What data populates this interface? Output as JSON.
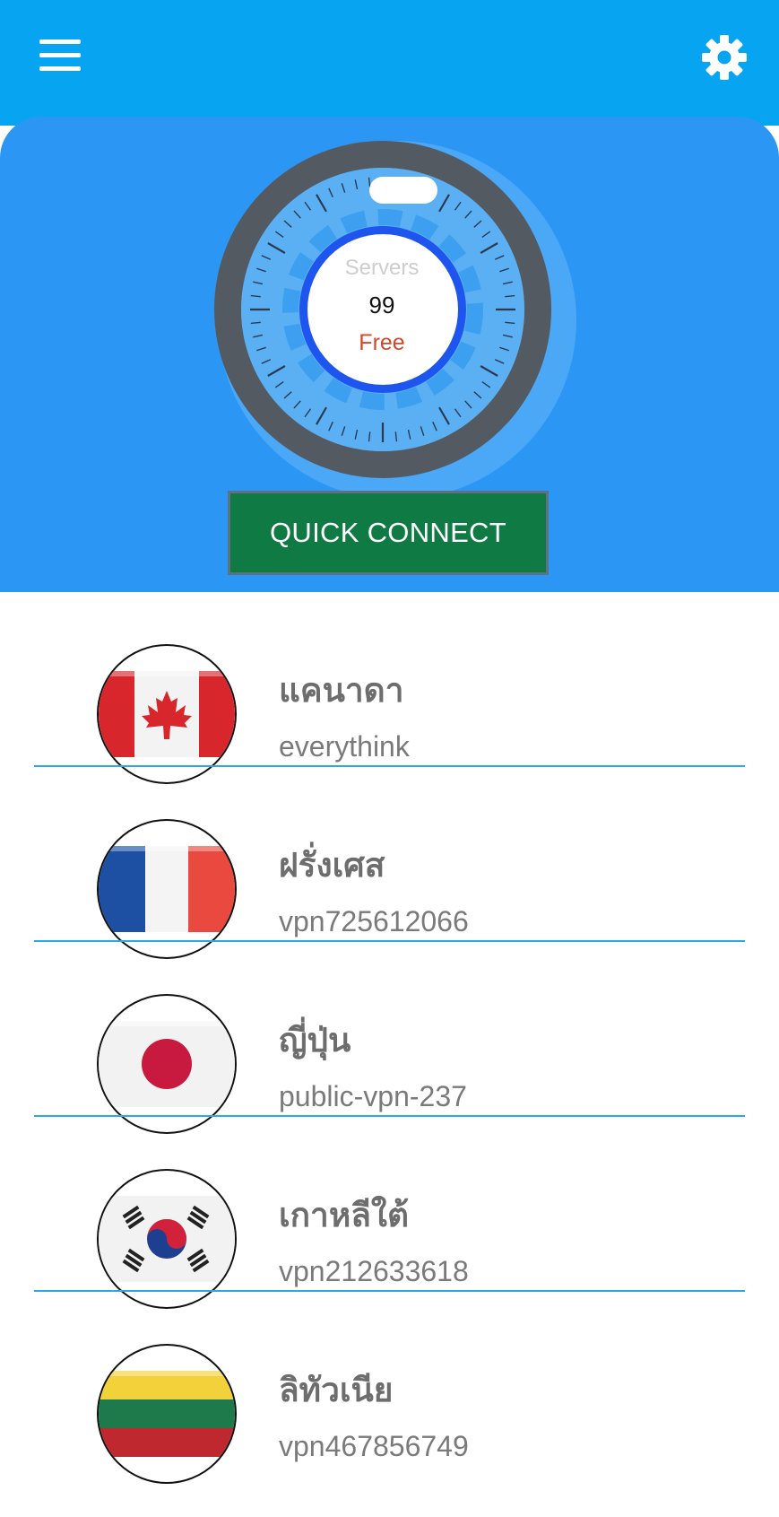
{
  "header": {
    "menu_icon": "hamburger-menu-icon",
    "settings_icon": "gear-icon",
    "bar_color": "#07a5f1"
  },
  "hero": {
    "background_color": "#2c96f4",
    "gauge": {
      "label": "Servers",
      "count": "99",
      "plan": "Free"
    },
    "quick_connect_label": "QUICK CONNECT",
    "quick_connect_color": "#0f7a44"
  },
  "servers": [
    {
      "country": "แคนาดา",
      "server": "everythink",
      "flag": "canada-flag"
    },
    {
      "country": "ฝรั่งเศส",
      "server": "vpn725612066",
      "flag": "france-flag"
    },
    {
      "country": "ญี่ปุ่น",
      "server": "public-vpn-237",
      "flag": "japan-flag"
    },
    {
      "country": "เกาหลีใต้",
      "server": "vpn212633618",
      "flag": "south-korea-flag"
    },
    {
      "country": "ลิทัวเนีย",
      "server": "vpn467856749",
      "flag": "lithuania-flag"
    }
  ]
}
